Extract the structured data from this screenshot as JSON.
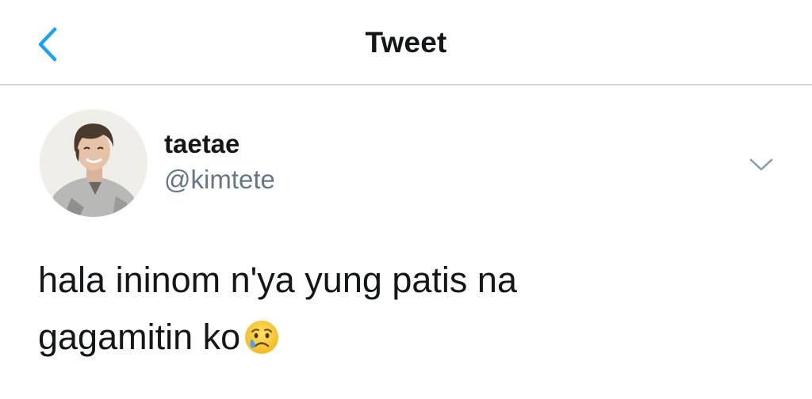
{
  "header": {
    "title": "Tweet",
    "back_icon": "chevron-left-icon"
  },
  "tweet": {
    "author": {
      "display_name": "taetae",
      "handle": "@kimtete"
    },
    "text_lines": [
      "hala ininom n'ya yung patis na",
      "gagamitin ko"
    ],
    "emoji": "crying-face-icon",
    "menu_icon": "chevron-down-icon"
  },
  "colors": {
    "accent": "#1da1f2",
    "text": "#14171a",
    "secondary_text": "#657786",
    "divider": "#d3d6d9"
  }
}
